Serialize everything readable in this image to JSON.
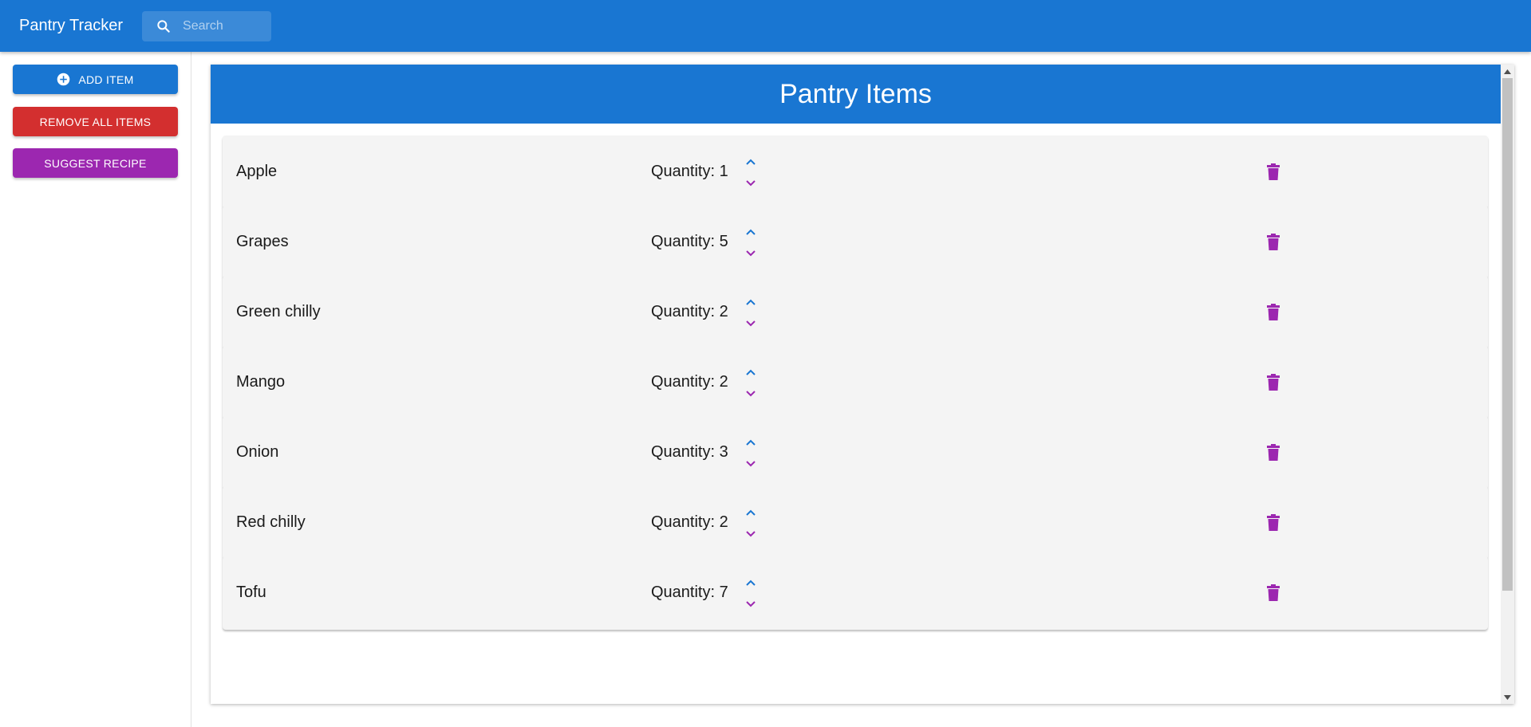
{
  "appbar": {
    "title": "Pantry Tracker",
    "search_placeholder": "Search",
    "search_value": ""
  },
  "sidebar": {
    "add_label": "ADD ITEM",
    "remove_all_label": "REMOVE ALL ITEMS",
    "suggest_label": "SUGGEST RECIPE"
  },
  "panel": {
    "title": "Pantry Items"
  },
  "items": [
    {
      "name": "Apple",
      "quantity_text": "Quantity: 1"
    },
    {
      "name": "Grapes",
      "quantity_text": "Quantity: 5"
    },
    {
      "name": "Green chilly",
      "quantity_text": "Quantity: 2"
    },
    {
      "name": "Mango",
      "quantity_text": "Quantity: 2"
    },
    {
      "name": "Onion",
      "quantity_text": "Quantity: 3"
    },
    {
      "name": "Red chilly",
      "quantity_text": "Quantity: 2"
    },
    {
      "name": "Tofu",
      "quantity_text": "Quantity: 7"
    }
  ],
  "icons": {
    "search": "search-icon",
    "add": "add-circle-icon",
    "increase": "chevron-up-icon",
    "decrease": "chevron-down-icon",
    "delete": "trash-icon"
  },
  "colors": {
    "primary": "#1976d2",
    "danger": "#d32f2f",
    "secondary": "#9c27b0",
    "card_background": "#f4f4f4"
  }
}
